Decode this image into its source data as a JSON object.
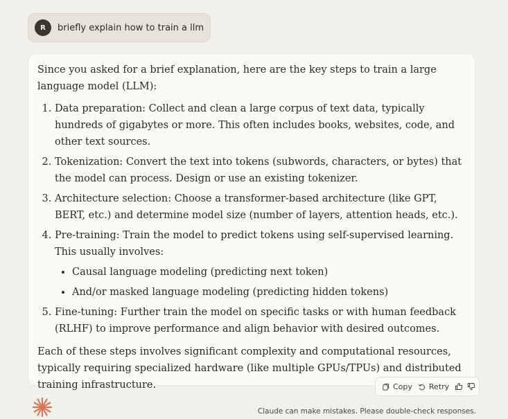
{
  "user": {
    "avatar_initial": "R",
    "message": "briefly explain how to train a llm"
  },
  "response": {
    "intro": "Since you asked for a brief explanation, here are the key steps to train a large language model (LLM):",
    "steps": [
      "Data preparation: Collect and clean a large corpus of text data, typically hundreds of gigabytes or more. This often includes books, websites, code, and other text sources.",
      "Tokenization: Convert the text into tokens (subwords, characters, or bytes) that the model can process. Design or use an existing tokenizer.",
      "Architecture selection: Choose a transformer-based architecture (like GPT, BERT, etc.) and determine model size (number of layers, attention heads, etc.).",
      "Pre-training: Train the model to predict tokens using self-supervised learning. This usually involves:",
      "Fine-tuning: Further train the model on specific tasks or with human feedback (RLHF) to improve performance and align behavior with desired outcomes."
    ],
    "pretraining_subitems": [
      "Causal language modeling (predicting next token)",
      "And/or masked language modeling (predicting hidden tokens)"
    ],
    "conclusion": "Each of these steps involves significant complexity and computational resources, typically requiring specialized hardware (like multiple GPUs/TPUs) and distributed training infrastructure."
  },
  "actions": {
    "copy_label": "Copy",
    "retry_label": "Retry",
    "icons": [
      "copy-icon",
      "retry-icon",
      "thumbs-up-icon",
      "thumbs-down-icon"
    ]
  },
  "footer": {
    "disclaimer": "Claude can make mistakes. Please double-check responses."
  },
  "colors": {
    "background": "#f1f0ea",
    "accent_logo": "#d97757",
    "user_bubble": "#e6e4da",
    "response_card": "#fbfaf6"
  }
}
